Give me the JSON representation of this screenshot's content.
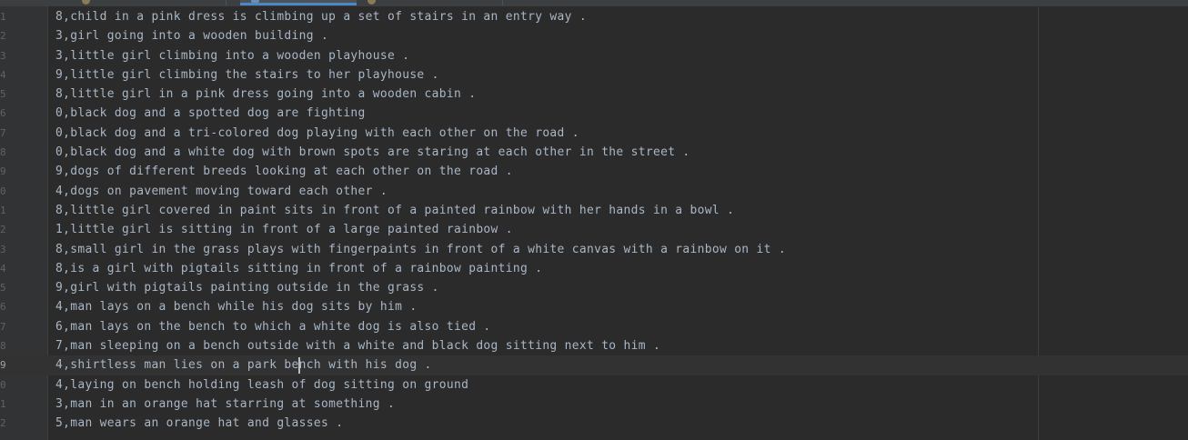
{
  "editor": {
    "lines": [
      {
        "number": "1",
        "text": "8,child in a pink dress is climbing up a set of stairs in an entry way ."
      },
      {
        "number": "2",
        "text": "3,girl going into a wooden building ."
      },
      {
        "number": "3",
        "text": "3,little girl climbing into a wooden playhouse ."
      },
      {
        "number": "4",
        "text": "9,little girl climbing the stairs to her playhouse ."
      },
      {
        "number": "5",
        "text": "8,little girl in a pink dress going into a wooden cabin ."
      },
      {
        "number": "6",
        "text": "0,black dog and a spotted dog are fighting"
      },
      {
        "number": "7",
        "text": "0,black dog and a tri-colored dog playing with each other on the road ."
      },
      {
        "number": "8",
        "text": "0,black dog and a white dog with brown spots are staring at each other in the street ."
      },
      {
        "number": "9",
        "text": "9,dogs of different breeds looking at each other on the road ."
      },
      {
        "number": "0",
        "text": "4,dogs on pavement moving toward each other ."
      },
      {
        "number": "1",
        "text": "8,little girl covered in paint sits in front of a painted rainbow with her hands in a bowl ."
      },
      {
        "number": "2",
        "text": "1,little girl is sitting in front of a large painted rainbow ."
      },
      {
        "number": "3",
        "text": "8,small girl in the grass plays with fingerpaints in front of a white canvas with a rainbow on it ."
      },
      {
        "number": "4",
        "text": "8,is a girl with pigtails sitting in front of a rainbow painting ."
      },
      {
        "number": "5",
        "text": "9,girl with pigtails painting outside in the grass ."
      },
      {
        "number": "6",
        "text": "4,man lays on a bench while his dog sits by him ."
      },
      {
        "number": "7",
        "text": "6,man lays on the bench to which a white dog is also tied ."
      },
      {
        "number": "8",
        "text": "7,man sleeping on a bench outside with a white and black dog sitting next to him ."
      },
      {
        "number": "9",
        "text": "4,shirtless man lies on a park bench with his dog ."
      },
      {
        "number": "0",
        "text": "4,laying on bench holding leash of dog sitting on ground"
      },
      {
        "number": "1",
        "text": "3,man in an orange hat starring at something ."
      },
      {
        "number": "2",
        "text": "5,man wears an orange hat and glasses ."
      }
    ],
    "current_line_index": 18
  }
}
